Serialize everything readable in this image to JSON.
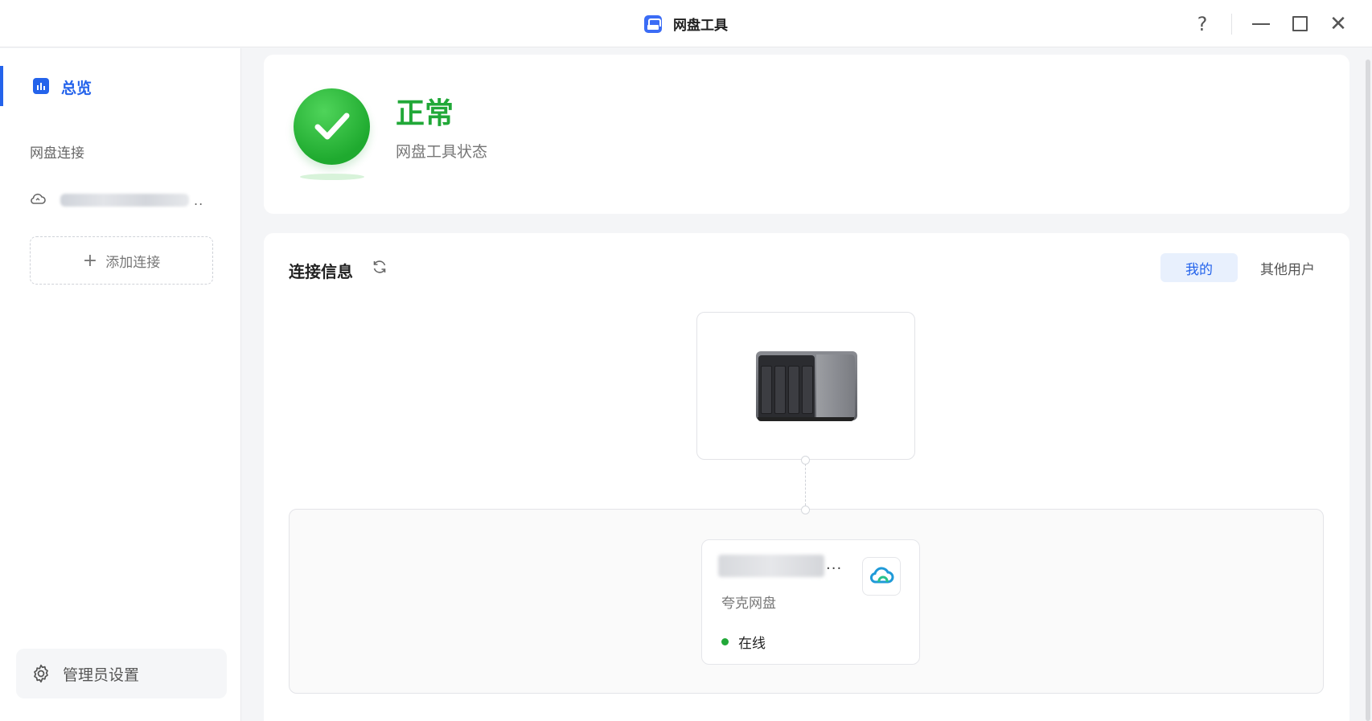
{
  "window": {
    "title": "网盘工具",
    "help": "?"
  },
  "sidebar": {
    "active_item": "总览",
    "section_label": "网盘连接",
    "connection_suffix": "..",
    "add_connection": "添加连接",
    "admin_settings": "管理员设置"
  },
  "status": {
    "title": "正常",
    "subtitle": "网盘工具状态",
    "color": "#21a838"
  },
  "connection": {
    "title": "连接信息",
    "tabs": [
      {
        "label": "我的",
        "active": true
      },
      {
        "label": "其他用户",
        "active": false
      }
    ],
    "cloud": {
      "name_suffix": "...",
      "provider": "夸克网盘",
      "status": "在线"
    }
  },
  "colors": {
    "accent": "#2463eb",
    "success": "#21a838"
  }
}
